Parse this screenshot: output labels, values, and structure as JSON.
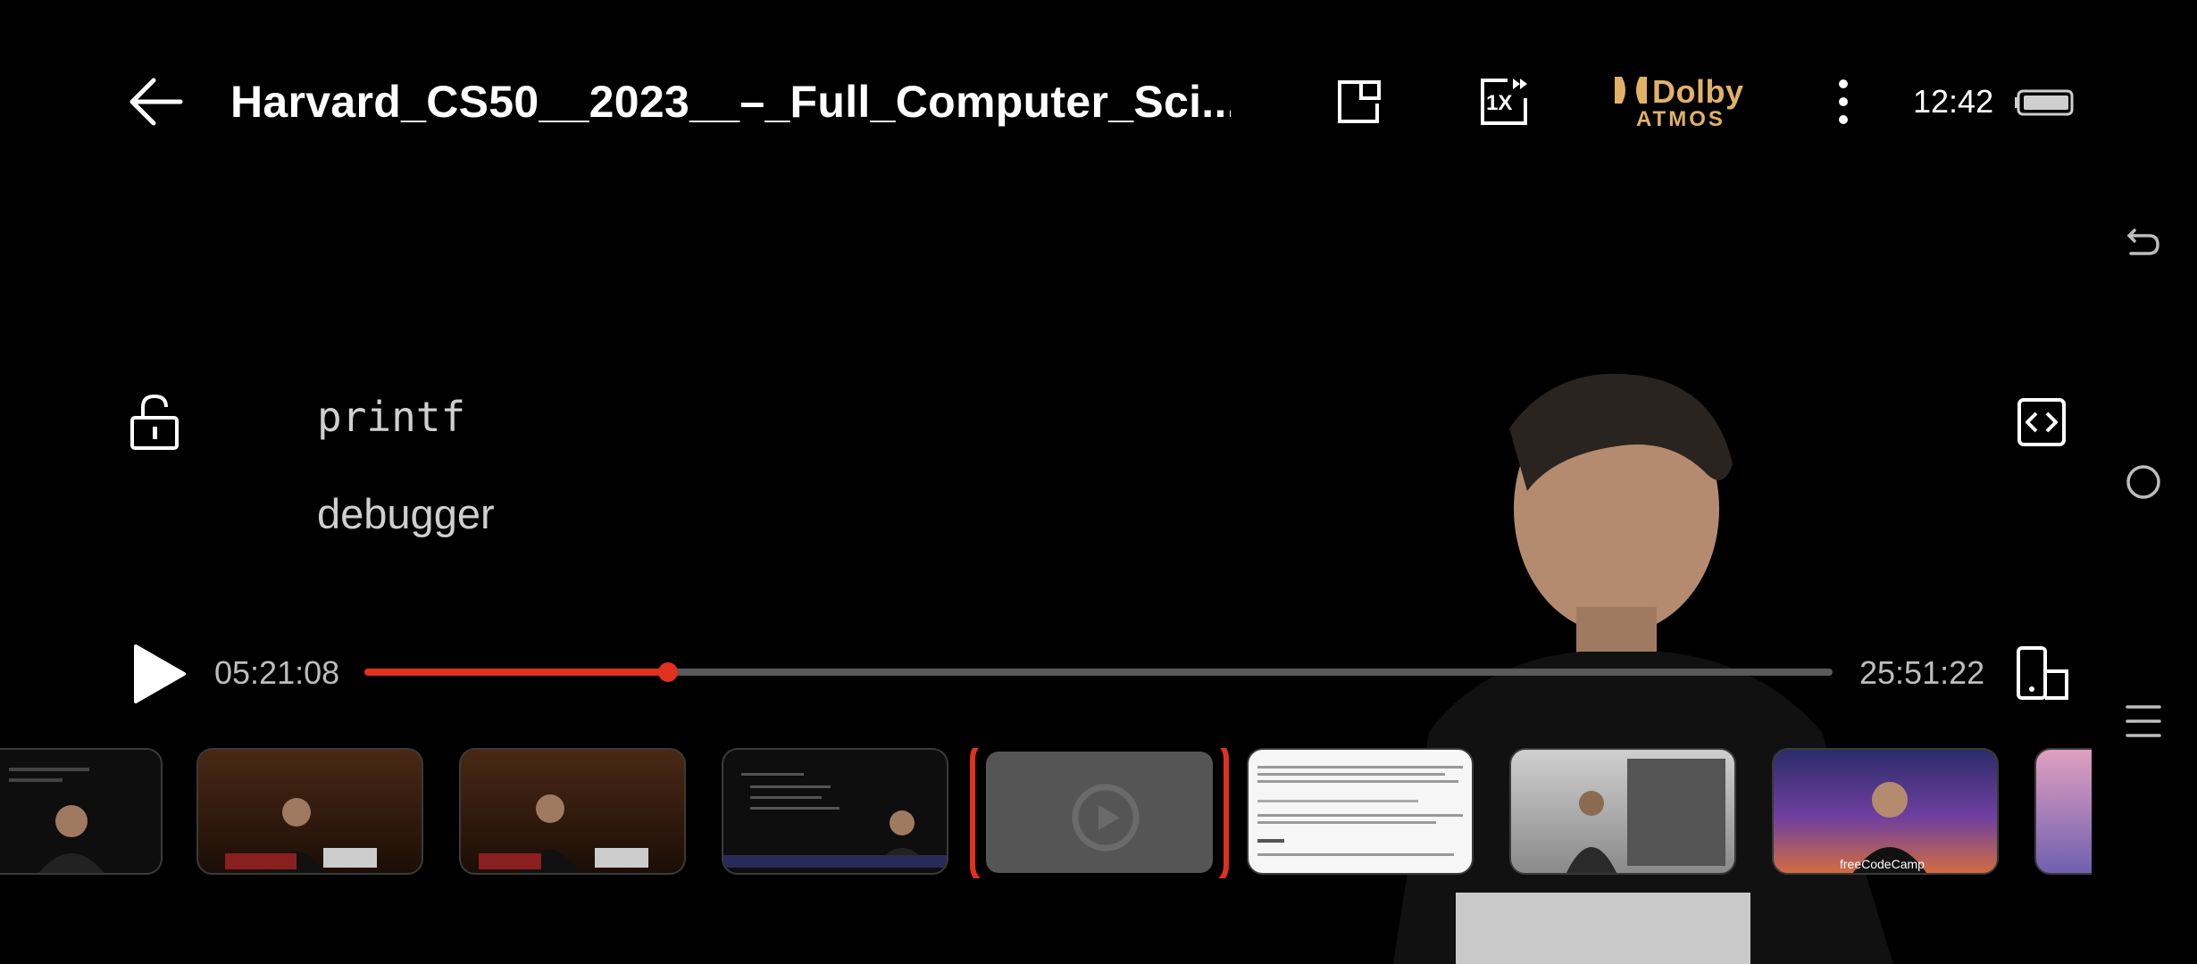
{
  "header": {
    "title": "Harvard_CS50__2023__–_Full_Computer_Sci...",
    "speed_label": "1X",
    "dolby_top": "Dolby",
    "dolby_bottom": "ATMOS",
    "clock": "12:42"
  },
  "subtitles": {
    "line1": "printf",
    "line2": "debugger"
  },
  "player": {
    "current_time": "05:21:08",
    "total_time": "25:51:22",
    "progress_percent": 20.7
  },
  "thumbnail_caption": "freeCodeCamp",
  "icons": {
    "back": "arrow-left-icon",
    "pip": "picture-in-picture-icon",
    "speed": "playback-speed-icon",
    "more": "more-vertical-icon",
    "battery": "battery-icon",
    "lock": "unlock-icon",
    "code": "code-brackets-icon",
    "play": "play-icon",
    "rotate": "screen-rotate-icon",
    "sys_back": "system-back-icon",
    "sys_home": "system-home-icon",
    "sys_menu": "system-menu-icon"
  },
  "colors": {
    "accent": "#e0301e",
    "dolby": "#e1b265",
    "background": "#000000"
  }
}
